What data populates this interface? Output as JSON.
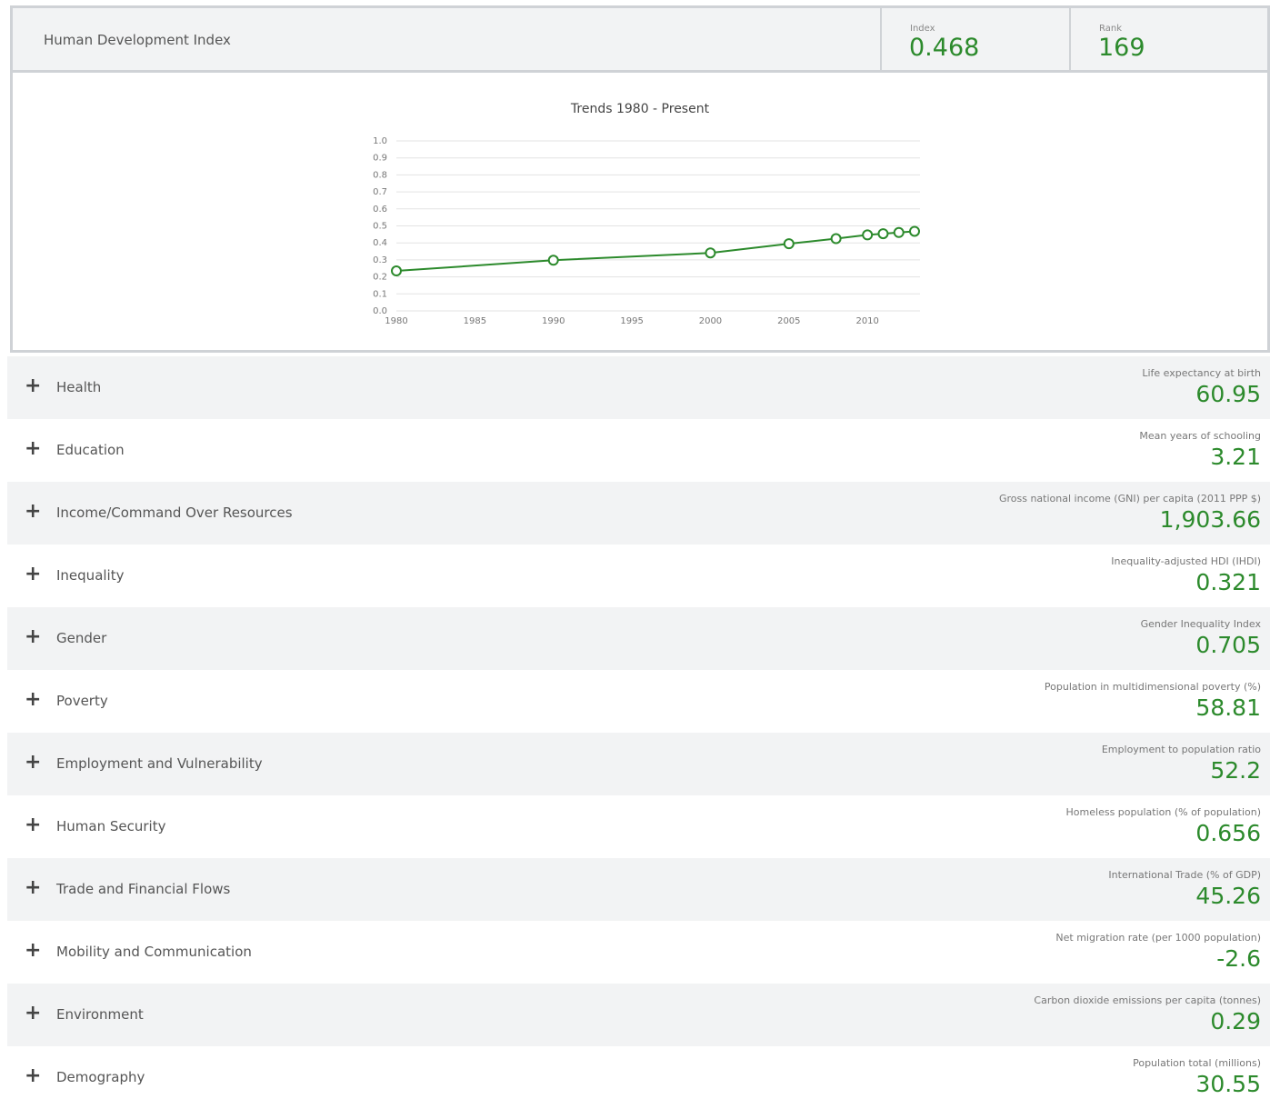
{
  "hdi": {
    "title": "Human Development Index",
    "index_label": "Index",
    "index_value": "0.468",
    "rank_label": "Rank",
    "rank_value": "169"
  },
  "chart_data": {
    "type": "line",
    "title": "Trends 1980 - Present",
    "xlabel": "",
    "ylabel": "",
    "x": [
      1980,
      1990,
      2000,
      2005,
      2008,
      2010,
      2011,
      2012,
      2013
    ],
    "values": [
      0.235,
      0.298,
      0.341,
      0.395,
      0.425,
      0.447,
      0.454,
      0.461,
      0.468
    ],
    "ylim": [
      0,
      1
    ],
    "xlim": [
      1980,
      2013
    ],
    "y_ticks": [
      "0.0",
      "0.1",
      "0.2",
      "0.3",
      "0.4",
      "0.5",
      "0.6",
      "0.7",
      "0.8",
      "0.9",
      "1.0"
    ],
    "x_ticks": [
      "1980",
      "1985",
      "1990",
      "1995",
      "2000",
      "2005",
      "2010"
    ],
    "grid": true,
    "color": "#2c8a2c"
  },
  "categories": [
    {
      "name": "Health",
      "metric": "Life expectancy at birth",
      "value": "60.95"
    },
    {
      "name": "Education",
      "metric": "Mean years of schooling",
      "value": "3.21"
    },
    {
      "name": "Income/Command Over Resources",
      "metric": "Gross national income (GNI) per capita (2011 PPP $)",
      "value": "1,903.66"
    },
    {
      "name": "Inequality",
      "metric": "Inequality-adjusted HDI (IHDI)",
      "value": "0.321"
    },
    {
      "name": "Gender",
      "metric": "Gender Inequality Index",
      "value": "0.705"
    },
    {
      "name": "Poverty",
      "metric": "Population in multidimensional poverty (%)",
      "value": "58.81"
    },
    {
      "name": "Employment and Vulnerability",
      "metric": "Employment to population ratio",
      "value": "52.2"
    },
    {
      "name": "Human Security",
      "metric": "Homeless population (% of population)",
      "value": "0.656"
    },
    {
      "name": "Trade and Financial Flows",
      "metric": "International Trade (% of GDP)",
      "value": "45.26"
    },
    {
      "name": "Mobility and Communication",
      "metric": "Net migration rate (per 1000 population)",
      "value": "-2.6"
    },
    {
      "name": "Environment",
      "metric": "Carbon dioxide emissions per capita (tonnes)",
      "value": "0.29"
    },
    {
      "name": "Demography",
      "metric": "Population total (millions)",
      "value": "30.55"
    }
  ],
  "icons": {
    "expand": "plus-icon"
  }
}
